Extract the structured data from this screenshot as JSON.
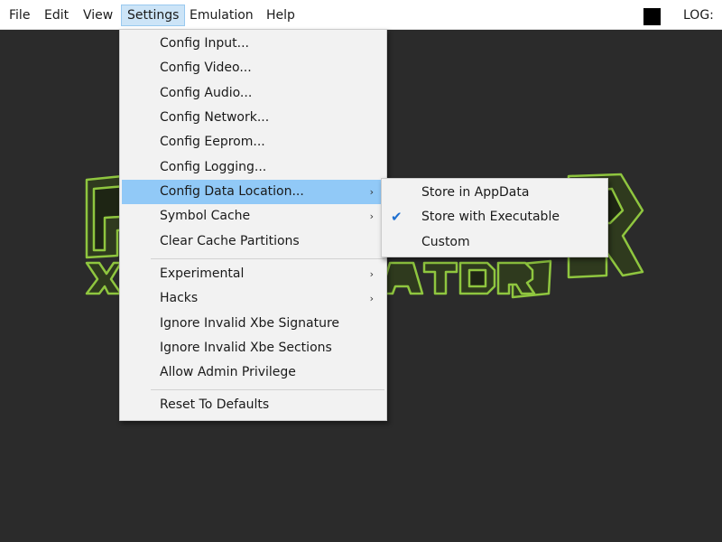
{
  "menubar": {
    "items": [
      {
        "label": "File"
      },
      {
        "label": "Edit"
      },
      {
        "label": "View"
      },
      {
        "label": "Settings"
      },
      {
        "label": "Emulation"
      },
      {
        "label": "Help"
      }
    ],
    "log_label": "LOG:"
  },
  "settings_menu": {
    "items": [
      {
        "label": "Config Input..."
      },
      {
        "label": "Config Video..."
      },
      {
        "label": "Config Audio..."
      },
      {
        "label": "Config Network..."
      },
      {
        "label": "Config Eeprom..."
      },
      {
        "label": "Config Logging..."
      },
      {
        "label": "Config Data Location...",
        "arrow": "›"
      },
      {
        "label": "Symbol Cache",
        "arrow": "›"
      },
      {
        "label": "Clear Cache Partitions"
      },
      {
        "label": "Experimental",
        "arrow": "›"
      },
      {
        "label": "Hacks",
        "arrow": "›"
      },
      {
        "label": "Ignore Invalid Xbe Signature"
      },
      {
        "label": "Ignore Invalid Xbe Sections"
      },
      {
        "label": "Allow Admin Privilege"
      },
      {
        "label": "Reset To Defaults"
      }
    ]
  },
  "data_location_submenu": {
    "items": [
      {
        "label": "Store in AppData",
        "checked": false
      },
      {
        "label": "Store with Executable",
        "checked": true,
        "check_glyph": "✔"
      },
      {
        "label": "Custom",
        "checked": false
      }
    ]
  },
  "colors": {
    "background": "#2b2b2b",
    "menu_bg": "#f2f2f2",
    "highlight": "#91c9f7",
    "logo_green": "#8fc63f",
    "logo_dark": "#2f3a1e"
  }
}
